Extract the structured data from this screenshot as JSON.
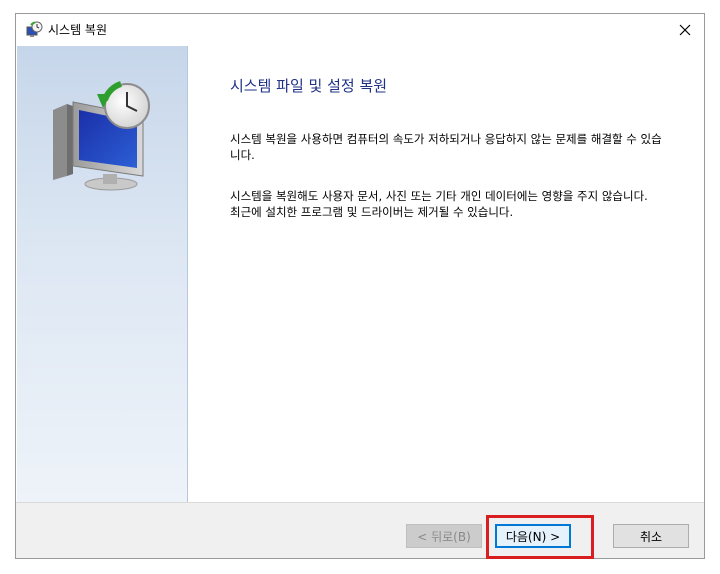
{
  "window": {
    "title": "시스템 복원",
    "icon": "system-restore-icon",
    "close_glyph": "✕"
  },
  "content": {
    "heading": "시스템 파일 및 설정 복원",
    "paragraph1": "시스템 복원을 사용하면 컴퓨터의 속도가 저하되거나 응답하지 않는 문제를 해결할 수 있습니다.",
    "paragraph2": "시스템을 복원해도 사용자 문서, 사진 또는 기타 개인 데이터에는 영향을 주지 않습니다. 최근에 설치한 프로그램 및 드라이버는 제거될 수 있습니다."
  },
  "buttons": {
    "back": "< 뒤로(B)",
    "next": "다음(N) >",
    "cancel": "취소"
  },
  "colors": {
    "heading": "#1e3287",
    "highlight": "#d81e1e",
    "focus": "#0078d7"
  }
}
